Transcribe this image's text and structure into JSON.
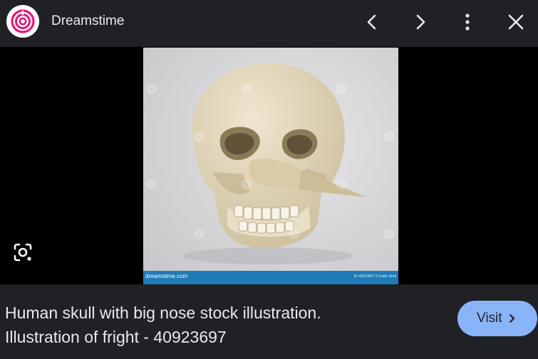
{
  "header": {
    "site_name": "Dreamstime",
    "logo_icon": "dreamstime-spiral-logo",
    "prev_icon": "chevron-left-icon",
    "next_icon": "chevron-right-icon",
    "more_icon": "more-vert-icon",
    "close_icon": "close-icon"
  },
  "viewer": {
    "image_subject": "skull with long nose",
    "watermark_left": "dreamstime.com",
    "watermark_right": "ID 40923697 © Fabio Berti",
    "lens_icon": "lens-search-icon"
  },
  "footer": {
    "caption_line1": "Human skull with big nose stock illustration.",
    "caption_line2": "Illustration of fright - 40923697",
    "visit_label": "Visit"
  },
  "colors": {
    "background": "#202124",
    "viewer_background": "#000000",
    "accent": "#8ab4f8",
    "logo_pink": "#e0197d",
    "text": "#e8eaed"
  }
}
